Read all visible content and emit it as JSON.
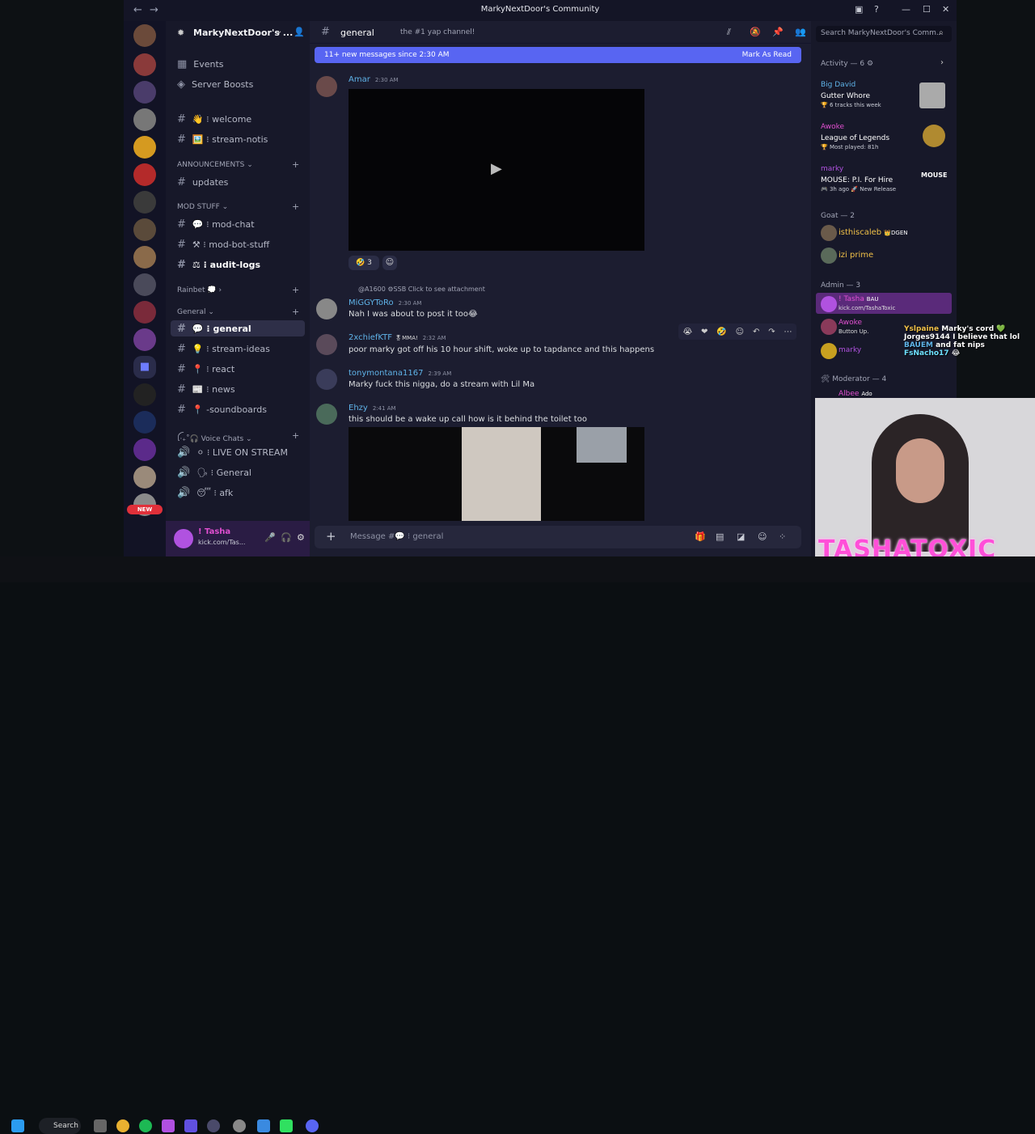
{
  "window": {
    "title": "MarkyNextDoor's Community",
    "back": "←",
    "forward": "→"
  },
  "server": {
    "name": "MarkyNextDoor's ...",
    "events": "Events",
    "boosts": "Server Boosts"
  },
  "channels": [
    {
      "label": "👋 ⁝ welcome"
    },
    {
      "label": "🖼️ ⁝ stream-notis"
    }
  ],
  "categories": {
    "announcements": "ANNOUNCEMENTS ⌄",
    "mod_stuff": "MOD STUFF ⌄",
    "rainbet": "Rainbet 💭 ›",
    "general": "General ⌄",
    "voice": "ꪶ‧₊˚🎧 Voice Chats ⌄"
  },
  "announcement_channels": [
    "updates"
  ],
  "mod_channels": [
    "💬 ⁝ mod-chat",
    "⚒ ⁝ mod-bot-stuff",
    "⚖ ⁝ audit-logs"
  ],
  "general_channels": [
    "💬 ⁝ general",
    "💡 ⁝ stream-ideas",
    "📍 ⁝ react",
    "📰 ⁝ news",
    "📍 -soundboards"
  ],
  "voice_channels": [
    "⚪ ⁝ LIVE ON STREAM",
    "🗣 ⁝ General",
    "😴 ⁝ afk"
  ],
  "user": {
    "name": "! Tasha",
    "status": "kick.com/Tas...",
    "new_badge": "NEW"
  },
  "channel_header": {
    "name": "general",
    "topic": "the #1 yap channel!",
    "search_placeholder": "Search MarkyNextDoor's Comm..."
  },
  "newbar": {
    "text": "11+ new messages since 2:30 AM",
    "action": "Mark As Read"
  },
  "messages": [
    {
      "user": "Amar",
      "time": "2:30 AM",
      "color": "#5fb3e8",
      "text": ""
    },
    {
      "user": "MiGGYToRo",
      "time": "2:30 AM",
      "color": "#5fb3e8",
      "text": "Nah I was about to post it too😂",
      "reply": "@A1600 ⚙SSB Click to see attachment"
    },
    {
      "user": "2xchiefKTF",
      "time": "2:32 AM",
      "color": "#5fb3e8",
      "text": "poor marky got off his 10 hour shift, woke up to tapdance and this happens",
      "tag": "🎖MMA!"
    },
    {
      "user": "tonymontana1167",
      "time": "2:39 AM",
      "color": "#5fb3e8",
      "text": "Marky fuck this nigga, do a stream with Lil Ma"
    },
    {
      "user": "Ehzy",
      "time": "2:41 AM",
      "color": "#5fb3e8",
      "text": "this should be a wake up call how is it behind the toilet too"
    }
  ],
  "reaction": {
    "emoji": "🤣",
    "count": "3"
  },
  "input_placeholder": "Message #💬 ⁝ general",
  "activity": {
    "header": "Activity — 6 ⚙",
    "items": [
      {
        "user": "Big David",
        "title": "Gutter Whore",
        "sub": "🏆 6 tracks this week",
        "color": "#5fb3e8"
      },
      {
        "user": "Awoke",
        "title": "League of Legends",
        "sub": "🏆 Most played: 81h",
        "color": "#e04fd0"
      },
      {
        "user": "marky",
        "title": "MOUSE: P.I. For Hire",
        "sub": "🎮 3h ago  🚀 New Release",
        "color": "#b052e0"
      }
    ],
    "goat_header": "Goat — 2",
    "goat": [
      "isthiscaleb",
      "izi prime"
    ],
    "goat_tag": "👑DGEN",
    "admin_header": "Admin — 3",
    "admins": [
      {
        "name": "! Tasha",
        "sub": "kick.com/TashaToxic",
        "tag": "BAU",
        "color": "#e04fd0"
      },
      {
        "name": "Awoke",
        "sub": "Button Up.",
        "tag": "",
        "color": "#e04fd0"
      },
      {
        "name": "marky",
        "sub": "",
        "tag": "",
        "color": "#b052e0"
      }
    ],
    "mod_header": "🛠 Moderator — 4",
    "mods": [
      {
        "name": "Albee",
        "tag": "Ado"
      }
    ]
  },
  "stream_chat": [
    {
      "user": "Yslpaine",
      "msg": "Marky's cord 💚"
    },
    {
      "user": "Jorges9144",
      "msg": "I believe that lol"
    },
    {
      "user": "BAUEM",
      "msg": "and fat nips"
    },
    {
      "user": "FsNacho17",
      "msg": "😂"
    }
  ],
  "overlay_logo": "TASHATOXIC",
  "taskbar": {
    "search": "Search"
  }
}
